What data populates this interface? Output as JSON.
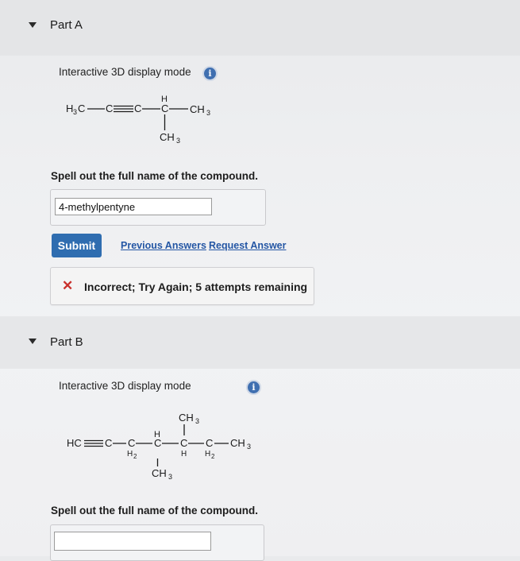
{
  "partA": {
    "title": "Part A",
    "display_mode": "Interactive 3D display mode",
    "molecule": {
      "h3c": "H",
      "h3c_sub": "3",
      "h3c_c": "C",
      "c1": "C",
      "c2": "C",
      "h": "H",
      "c3": "C",
      "ch3_right": "CH",
      "ch3_right_sub": "3",
      "ch3_down": "CH",
      "ch3_down_sub": "3"
    },
    "prompt": "Spell out the full name of the compound.",
    "answer_value": "4-methylpentyne",
    "submit_label": "Submit",
    "previous_answers": "Previous Answers",
    "request_answer": "Request Answer",
    "feedback_icon": "✕",
    "feedback_text": "Incorrect; Try Again; 5 attempts remaining"
  },
  "partB": {
    "title": "Part B",
    "display_mode": "Interactive 3D display mode",
    "molecule": {
      "hc": "HC",
      "c1": "C",
      "c2": "C",
      "h2a": "H",
      "h2a_sub": "2",
      "h_top": "H",
      "c3": "C",
      "ch3_top": "CH",
      "ch3_top_sub": "3",
      "c4": "C",
      "h_bottom": "H",
      "c5": "C",
      "h2b": "H",
      "h2b_sub": "2",
      "ch3_right": "CH",
      "ch3_right_sub": "3",
      "ch3_down": "CH",
      "ch3_down_sub": "3"
    },
    "prompt": "Spell out the full name of the compound.",
    "answer_value": ""
  },
  "colors": {
    "accent": "#2f6db0",
    "link": "#2456a4",
    "error": "#c9302c"
  }
}
